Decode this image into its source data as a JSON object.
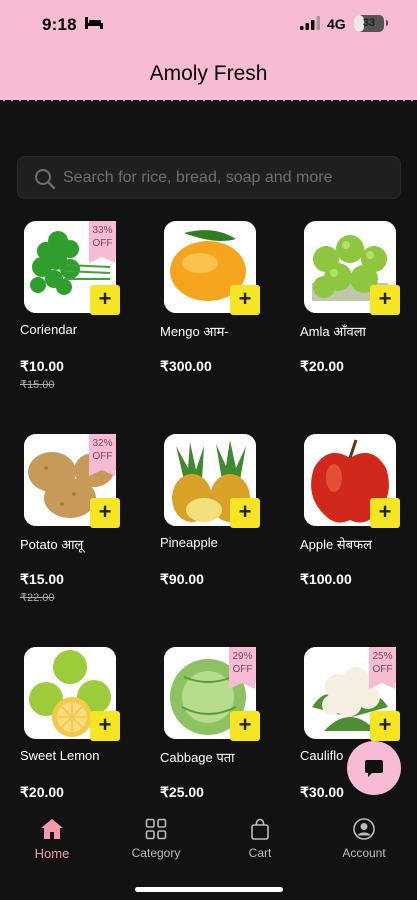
{
  "status_bar": {
    "time": "9:18",
    "network": "4G",
    "battery": "33",
    "battery_level": 0.33
  },
  "header": {
    "title": "Amoly Fresh"
  },
  "search": {
    "placeholder": "Search for rice, bread, soap and more"
  },
  "products": [
    {
      "name": "Coriendar",
      "price": "₹10.00",
      "old_price": "₹15.00",
      "discount": "33% OFF",
      "image": "coriander"
    },
    {
      "name": "Mengo आम-",
      "price": "₹300.00",
      "old_price": "",
      "discount": "",
      "image": "mango"
    },
    {
      "name": "Amla आँवला",
      "price": "₹20.00",
      "old_price": "",
      "discount": "",
      "image": "amla"
    },
    {
      "name": "Potato आलू",
      "price": "₹15.00",
      "old_price": "₹22.00",
      "discount": "32% OFF",
      "image": "potato"
    },
    {
      "name": "Pineapple",
      "price": "₹90.00",
      "old_price": "",
      "discount": "",
      "image": "pineapple"
    },
    {
      "name": "Apple सेबफल",
      "price": "₹100.00",
      "old_price": "",
      "discount": "",
      "image": "apple"
    },
    {
      "name": "Sweet Lemon",
      "price": "₹20.00",
      "old_price": "",
      "discount": "",
      "image": "sweet-lemon"
    },
    {
      "name": "Cabbage पता",
      "price": "₹25.00",
      "old_price": "",
      "discount": "29% OFF",
      "image": "cabbage"
    },
    {
      "name": "Cauliflo",
      "price": "₹30.00",
      "old_price": "",
      "discount": "25% OFF",
      "image": "cauliflower"
    }
  ],
  "add_label": "+",
  "nav": {
    "home": "Home",
    "category": "Category",
    "cart": "Cart",
    "account": "Account"
  },
  "colors": {
    "brand_pink": "#f7bcd3",
    "add_yellow": "#f5e522",
    "active_nav": "#f29aa9",
    "background": "#121212"
  }
}
